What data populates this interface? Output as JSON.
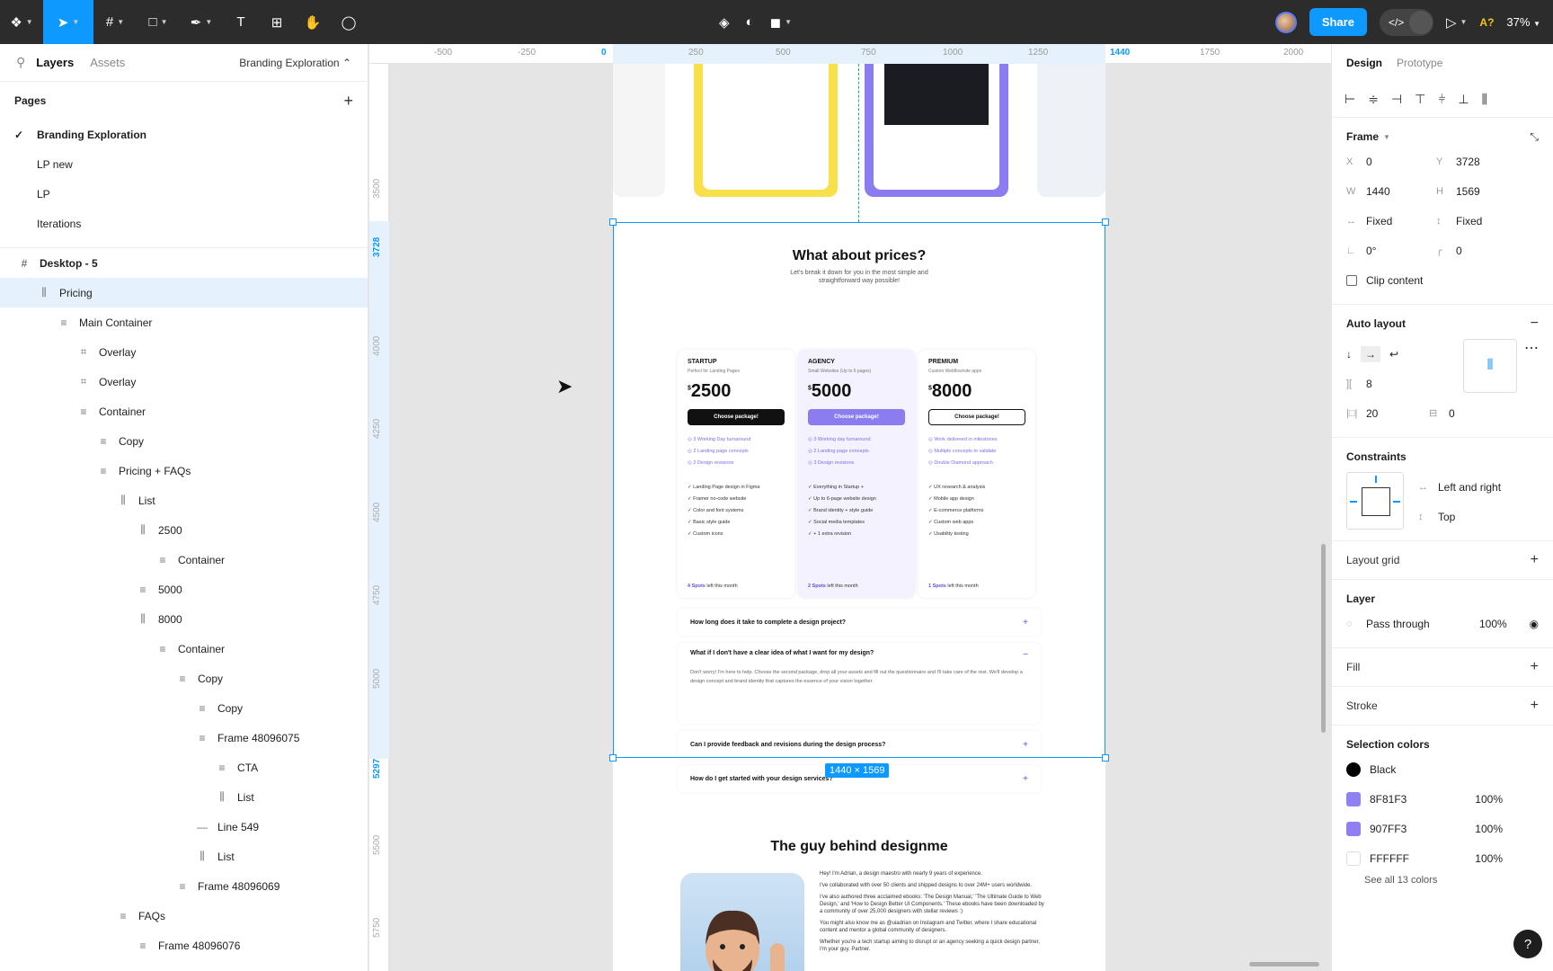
{
  "toolbar": {
    "tools": [
      "main-menu",
      "move",
      "frame",
      "shape",
      "pen",
      "text",
      "resources",
      "hand",
      "comment"
    ],
    "share_label": "Share",
    "zoom": "37%",
    "ai_label": "A?"
  },
  "left_panel": {
    "tabs": [
      "Layers",
      "Assets"
    ],
    "page_selector": "Branding Exploration",
    "pages_heading": "Pages",
    "pages": [
      "Branding Exploration",
      "LP new",
      "LP",
      "Iterations"
    ],
    "layers": [
      {
        "label": "Desktop - 5",
        "indent": 0
      },
      {
        "label": "Pricing",
        "indent": 1
      },
      {
        "label": "Main Container",
        "indent": 2
      },
      {
        "label": "Overlay",
        "indent": 3
      },
      {
        "label": "Overlay",
        "indent": 3
      },
      {
        "label": "Container",
        "indent": 3
      },
      {
        "label": "Copy",
        "indent": 4
      },
      {
        "label": "Pricing + FAQs",
        "indent": 4
      },
      {
        "label": "List",
        "indent": 5
      },
      {
        "label": "2500",
        "indent": 6
      },
      {
        "label": "Container",
        "indent": 7
      },
      {
        "label": "5000",
        "indent": 6
      },
      {
        "label": "8000",
        "indent": 6
      },
      {
        "label": "Container",
        "indent": 7
      },
      {
        "label": "Copy",
        "indent": 8
      },
      {
        "label": "Copy",
        "indent": 9
      },
      {
        "label": "Frame 48096075",
        "indent": 9
      },
      {
        "label": "CTA",
        "indent": 10
      },
      {
        "label": "List",
        "indent": 10
      },
      {
        "label": "Line 549",
        "indent": 9
      },
      {
        "label": "List",
        "indent": 9
      },
      {
        "label": "Frame 48096069",
        "indent": 8
      },
      {
        "label": "FAQs",
        "indent": 5
      },
      {
        "label": "Frame 48096076",
        "indent": 6
      }
    ]
  },
  "canvas": {
    "ruler_top": [
      "-500",
      "-250",
      "0",
      "250",
      "500",
      "750",
      "1000",
      "1250",
      "1440",
      "1750",
      "2000"
    ],
    "ruler_left": [
      "3500",
      "3728",
      "4000",
      "4250",
      "4500",
      "4750",
      "5000",
      "5297",
      "5500",
      "5750"
    ],
    "size_tag": "1440 × 1569",
    "pricing": {
      "title": "What about prices?",
      "subtitle_1": "Let's break it down for you in the most simple and",
      "subtitle_2": "straightforward way possible!",
      "plans": [
        {
          "name": "STARTUP",
          "sub": "Perfect for Landing Pages",
          "price": "2500",
          "btn": "Choose package!",
          "f1": [
            "3 Working Day turnaround",
            "2 Landing page concepts",
            "2 Design revisions"
          ],
          "f2": [
            "Landing Page design in Figma",
            "Framer no-code website",
            "Color and font systems",
            "Basic style guide",
            "Custom icons"
          ],
          "spots": "4 Spots",
          "spots_tail": " left this month"
        },
        {
          "name": "AGENCY",
          "sub": "Small Websites (Up to 6 pages)",
          "price": "5000",
          "btn": "Choose package!",
          "f1": [
            "3 Working day turnaround",
            "2 Landing page concepts",
            "3 Design revisions"
          ],
          "f2": [
            "Everything in Startup +",
            "Up to 6-page website design",
            "Brand identity + style guide",
            "Social media templates",
            "+ 1 extra revision"
          ],
          "spots": "2 Spots",
          "spots_tail": " left this month"
        },
        {
          "name": "PREMIUM",
          "sub": "Custom Webflow/site apps",
          "price": "8000",
          "btn": "Choose package!",
          "f1": [
            "Work delivered in milestones",
            "Multiple concepts to validate",
            "Double Diamond approach"
          ],
          "f2": [
            "UX research & analysis",
            "Mobile app design",
            "E-commerce platforms",
            "Custom web apps",
            "Usability testing"
          ],
          "spots": "1 Spots",
          "spots_tail": " left this month"
        }
      ],
      "faqs": [
        "How long does it take to complete a design project?",
        "What if I don't have a clear idea of what I want for my design?",
        "Can I provide feedback and revisions during the design process?",
        "How do I get started with your design services?"
      ],
      "faq_answer": "Don't worry! I'm here to help. Choose the second package, drop all your assets and fill out the questionnaire and I'll take care of the rest. We'll develop a design concept and brand identity that captures the essence of your vision together."
    },
    "about": {
      "title": "The guy behind designme",
      "p1": "Hey! I'm Adrian, a design maestro with nearly 9 years of experience.",
      "p2": "I've collaborated with over 50 clients and shipped designs to over 24M+ users worldwide.",
      "p3": "I've also authored three acclaimed ebooks: 'The Design Manual,' 'The Ultimate Guide to Web Design,' and 'How to Design Better UI Components.' These ebooks have been downloaded by a community of over 25,000 designers with stellar reviews :)",
      "p4": "You might also know me as @uiadrian on Instagram and Twitter, where I share educational content and mentor a global community of designers.",
      "p5": "Whether you're a tech startup aiming to disrupt or an agency seeking a quick design partner, I'm your guy. Partner."
    }
  },
  "right_panel": {
    "tabs": [
      "Design",
      "Prototype"
    ],
    "frame_label": "Frame",
    "x": "0",
    "y": "3728",
    "w": "1440",
    "h": "1569",
    "w_mode": "Fixed",
    "h_mode": "Fixed",
    "rotation": "0°",
    "radius": "0",
    "clip_label": "Clip content",
    "auto_layout_label": "Auto layout",
    "gap": "8",
    "padding_h": "20",
    "padding_v": "0",
    "constraints_label": "Constraints",
    "constraint_h": "Left and right",
    "constraint_v": "Top",
    "layout_grid_label": "Layout grid",
    "layer_label": "Layer",
    "blend": "Pass through",
    "opacity": "100%",
    "fill_label": "Fill",
    "stroke_label": "Stroke",
    "selection_colors_label": "Selection colors",
    "colors": [
      {
        "name": "Black",
        "hex": "#000000",
        "pct": ""
      },
      {
        "name": "8F81F3",
        "hex": "#8F81F3",
        "pct": "100%"
      },
      {
        "name": "907FF3",
        "hex": "#907FF3",
        "pct": "100%"
      },
      {
        "name": "FFFFFF",
        "hex": "#FFFFFF",
        "pct": "100%"
      }
    ],
    "see_all": "See all 13 colors"
  }
}
